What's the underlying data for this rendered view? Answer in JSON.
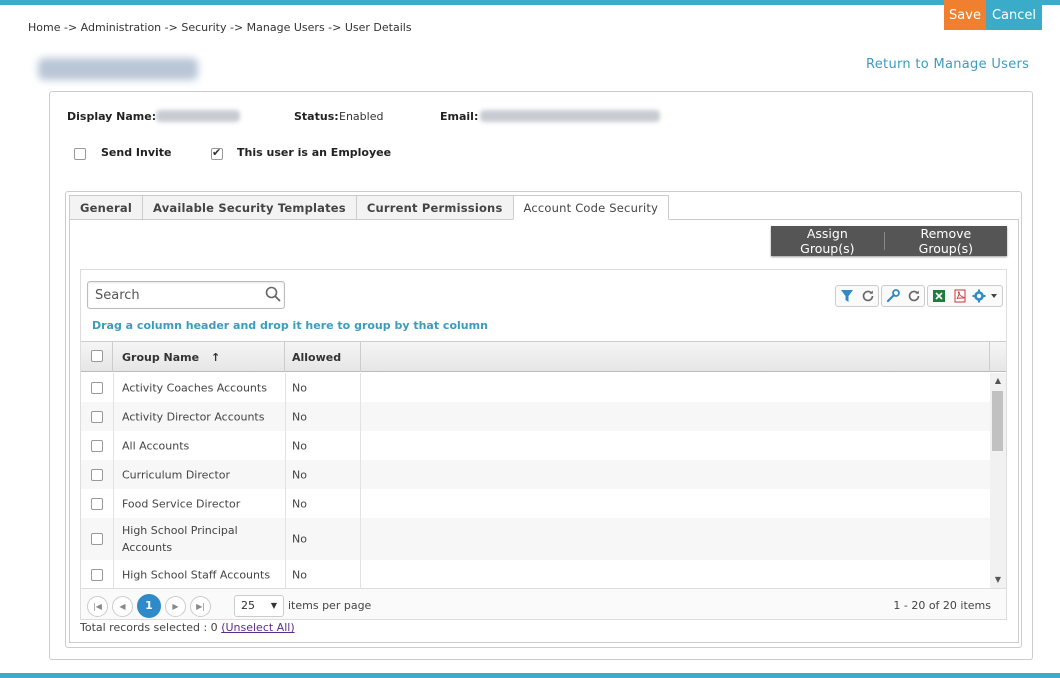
{
  "breadcrumb": "Home -> Administration -> Security -> Manage Users -> User Details",
  "actions": {
    "save": "Save",
    "cancel": "Cancel"
  },
  "return_link": "Return to Manage Users",
  "user": {
    "display_name_label": "Display Name:",
    "status_label": "Status:",
    "status_value": "Enabled",
    "email_label": "Email:",
    "send_invite_label": "Send Invite",
    "send_invite_checked": false,
    "employee_label": "This user is an Employee",
    "employee_checked": true
  },
  "tabs": [
    {
      "label": "General",
      "active": false
    },
    {
      "label": "Available Security Templates",
      "active": false
    },
    {
      "label": "Current Permissions",
      "active": false
    },
    {
      "label": "Account Code Security",
      "active": true
    }
  ],
  "group_actions": {
    "assign": "Assign Group(s)",
    "remove": "Remove Group(s)"
  },
  "grid": {
    "search_placeholder": "Search",
    "drag_hint": "Drag a column header and drop it here to group by that column",
    "columns": {
      "group_name": "Group Name",
      "sort_arrow": "↑",
      "allowed": "Allowed"
    },
    "rows": [
      {
        "name": "Activity Coaches Accounts",
        "allowed": "No"
      },
      {
        "name": "Activity Director Accounts",
        "allowed": "No"
      },
      {
        "name": "All Accounts",
        "allowed": "No"
      },
      {
        "name": "Curriculum Director",
        "allowed": "No"
      },
      {
        "name": "Food Service Director",
        "allowed": "No"
      },
      {
        "name": "High School Principal Accounts",
        "allowed": "No"
      },
      {
        "name": "High School Staff Accounts",
        "allowed": "No"
      }
    ],
    "pager": {
      "current_page": "1",
      "page_size": "25",
      "per_page_label": "items per page",
      "range": "1 - 20 of 20 items"
    },
    "total_selected_label": "Total records selected : 0",
    "unselect_all": "(Unselect All)"
  },
  "colors": {
    "accent": "#3aacc9",
    "save": "#f0802f",
    "link": "#3a9cbf",
    "pager_current": "#2e8ac9"
  }
}
